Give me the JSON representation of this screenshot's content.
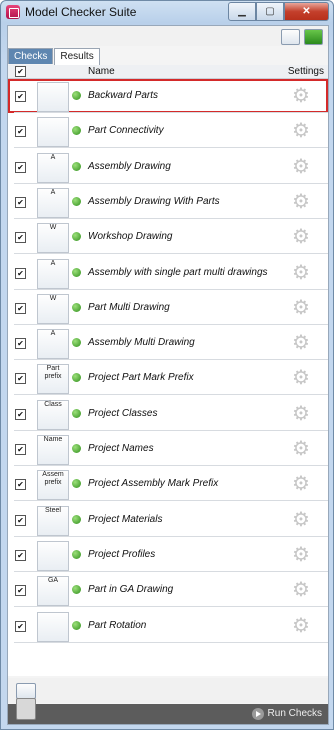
{
  "window": {
    "title": "Model Checker Suite"
  },
  "tabs": [
    {
      "label": "Checks"
    },
    {
      "label": "Results"
    }
  ],
  "columns": {
    "name": "Name",
    "settings": "Settings"
  },
  "rows": [
    {
      "name": "Backward Parts",
      "thumb": "",
      "highlighted": true
    },
    {
      "name": "Part Connectivity",
      "thumb": ""
    },
    {
      "name": "Assembly Drawing",
      "thumb": "A"
    },
    {
      "name": "Assembly Drawing With Parts",
      "thumb": "A"
    },
    {
      "name": "Workshop Drawing",
      "thumb": "W"
    },
    {
      "name": "Assembly with single part multi drawings",
      "thumb": "A"
    },
    {
      "name": "Part Multi Drawing",
      "thumb": "W"
    },
    {
      "name": "Assembly Multi Drawing",
      "thumb": "A"
    },
    {
      "name": "Project Part Mark Prefix",
      "thumb": "Part prefix"
    },
    {
      "name": "Project Classes",
      "thumb": "Class"
    },
    {
      "name": "Project Names",
      "thumb": "Name"
    },
    {
      "name": "Project Assembly Mark Prefix",
      "thumb": "Assem prefix"
    },
    {
      "name": "Project Materials",
      "thumb": "Steel"
    },
    {
      "name": "Project Profiles",
      "thumb": ""
    },
    {
      "name": "Part in GA Drawing",
      "thumb": "GA"
    },
    {
      "name": "Part Rotation",
      "thumb": ""
    }
  ],
  "footer": {
    "run_label": "Run Checks"
  },
  "colors": {
    "highlight": "#d42a2a",
    "ok": "#2f8e1c",
    "footer_bg": "#5c5c5c"
  }
}
